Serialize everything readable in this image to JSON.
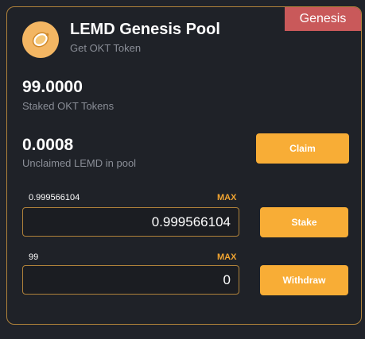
{
  "badge": "Genesis",
  "header": {
    "title": "LEMD Genesis Pool",
    "subtitle": "Get OKT Token",
    "logo_icon": "lemon-icon"
  },
  "staked": {
    "value": "99.0000",
    "caption": "Staked OKT Tokens"
  },
  "unclaimed": {
    "value": "0.0008",
    "caption": "Unclaimed LEMD in pool",
    "claim_label": "Claim"
  },
  "stake": {
    "balance": "0.999566104",
    "max_label": "MAX",
    "input_value": "0.999566104",
    "button_label": "Stake"
  },
  "withdraw": {
    "balance": "99",
    "max_label": "MAX",
    "input_value": "0",
    "button_label": "Withdraw"
  },
  "colors": {
    "accent": "#f8ad36",
    "badge": "#c9595a",
    "border": "#b0823a",
    "background": "#1f2228"
  }
}
